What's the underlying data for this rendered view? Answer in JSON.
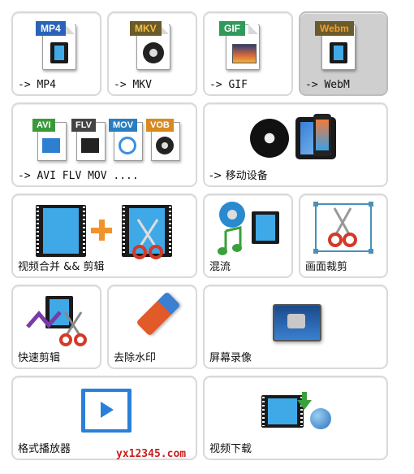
{
  "tiles": {
    "mp4": {
      "label": "-> MP4",
      "badge": "MP4",
      "badge_color": "#2b63b8"
    },
    "mkv": {
      "label": "-> MKV",
      "badge": "MKV",
      "badge_color": "#6b5a2a"
    },
    "gif": {
      "label": "-> GIF",
      "badge": "GIF",
      "badge_color": "#2f9a5a"
    },
    "webm": {
      "label": "-> WebM",
      "badge": "Webm",
      "badge_color": "#d88a1f"
    },
    "avi_flv_mov": {
      "label": "-> AVI FLV MOV ....",
      "badges": [
        "AVI",
        "FLV",
        "MOV",
        "VOB"
      ]
    },
    "mobile": {
      "label": "-> 移动设备"
    },
    "merge": {
      "label": "视频合并 && 剪辑"
    },
    "mix": {
      "label": "混流"
    },
    "crop": {
      "label": "画面裁剪"
    },
    "quick_cut": {
      "label": "快速剪辑"
    },
    "watermark_remove": {
      "label": "去除水印"
    },
    "screen_record": {
      "label": "屏幕录像"
    },
    "player": {
      "label": "格式播放器"
    },
    "download": {
      "label": "视频下载"
    }
  },
  "watermark": "yx12345.com"
}
